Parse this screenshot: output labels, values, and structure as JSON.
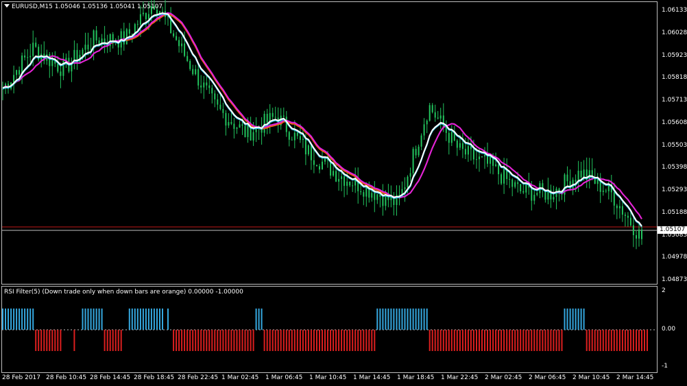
{
  "window": {
    "symbol_header": "EURUSD,M15  1.05046 1.05136 1.05041 1.05107"
  },
  "indicator": {
    "header": "RSI Filter(5)  (Down trade only when down bars are orange) 0.00000 -1.00000",
    "scale_labels": [
      "2",
      "0.00",
      "-1"
    ]
  },
  "price_axis": {
    "labels": [
      "1.06133",
      "1.06028",
      "1.05923",
      "1.05818",
      "1.05713",
      "1.05608",
      "1.05503",
      "1.05398",
      "1.05293",
      "1.05188",
      "1.05083",
      "1.04978",
      "1.04873"
    ],
    "current_price": "1.05107"
  },
  "time_axis": {
    "labels": [
      "28 Feb 2017",
      "28 Feb 10:45",
      "28 Feb 14:45",
      "28 Feb 18:45",
      "28 Feb 22:45",
      "1 Mar 02:45",
      "1 Mar 06:45",
      "1 Mar 10:45",
      "1 Mar 14:45",
      "1 Mar 18:45",
      "1 Mar 22:45",
      "2 Mar 02:45",
      "2 Mar 06:45",
      "2 Mar 10:45",
      "2 Mar 14:45"
    ]
  },
  "colors": {
    "background": "#000000",
    "candles": "#22c55e",
    "ma_white": "#ffffff",
    "ma_cyan": "#39c6e6",
    "ma_magenta": "#e020e0",
    "ma_orange": "#f06018",
    "rsi_up_bars": "#35a8e0",
    "rsi_down_bars": "#dd1f1f",
    "price_line": "#c01818"
  },
  "chart_data": {
    "type": "line",
    "ylim": [
      1.04873,
      1.0616
    ],
    "series_keypoints": [
      1.0577,
      1.0596,
      1.0586,
      1.06,
      1.06,
      1.0618,
      1.0592,
      1.0568,
      1.0556,
      1.0564,
      1.0548,
      1.0537,
      1.053,
      1.0523,
      1.0569,
      1.0548,
      1.0541,
      1.0529,
      1.0528,
      1.0538,
      1.0528,
      1.0507
    ],
    "rsi_blocks": [
      {
        "dir": 1,
        "n": 12
      },
      {
        "dir": -1,
        "n": 10
      },
      {
        "dir": 0,
        "n": 4
      },
      {
        "dir": -1,
        "n": 1
      },
      {
        "dir": 0,
        "n": 2
      },
      {
        "dir": 1,
        "n": 8
      },
      {
        "dir": -1,
        "n": 7
      },
      {
        "dir": 0,
        "n": 2
      },
      {
        "dir": 1,
        "n": 13
      },
      {
        "dir": 0,
        "n": 1
      },
      {
        "dir": 1,
        "n": 1
      },
      {
        "dir": 0,
        "n": 1
      },
      {
        "dir": -1,
        "n": 29
      },
      {
        "dir": -1,
        "n": 1
      },
      {
        "dir": 1,
        "n": 3
      },
      {
        "dir": -1,
        "n": 12
      },
      {
        "dir": -1,
        "n": 15
      },
      {
        "dir": -1,
        "n": 14
      },
      {
        "dir": 1,
        "n": 19
      },
      {
        "dir": -1,
        "n": 15
      },
      {
        "dir": -1,
        "n": 29
      },
      {
        "dir": -1,
        "n": 5
      },
      {
        "dir": 1,
        "n": 8
      },
      {
        "dir": -1,
        "n": 23
      }
    ]
  }
}
